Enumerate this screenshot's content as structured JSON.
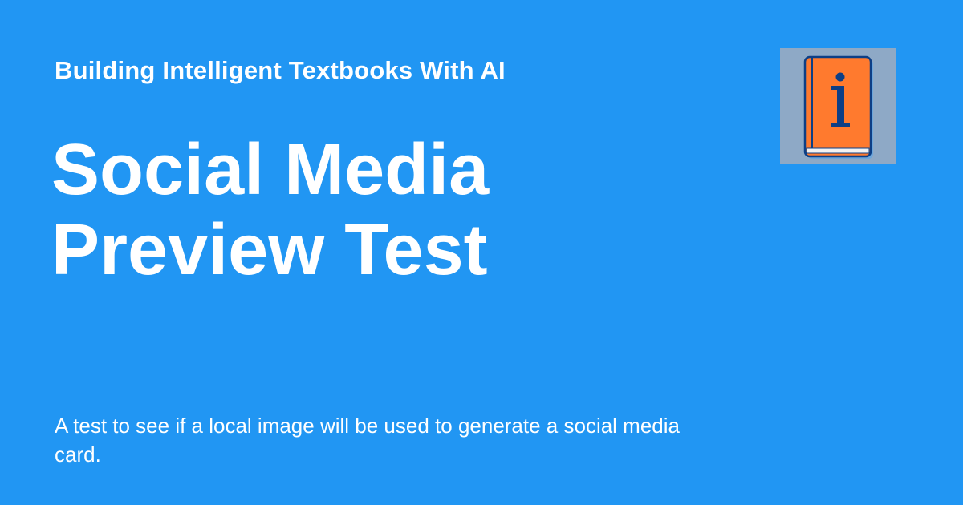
{
  "site_name": "Building Intelligent Textbooks With AI",
  "page_title": "Social Media Preview Test",
  "description": "A test to see if a local image will be used to generate a social media card.",
  "logo": {
    "icon": "orange-book-info-icon",
    "letter": "i"
  },
  "colors": {
    "background": "#2196f3",
    "text": "#ffffff",
    "book": "#ff7a2e",
    "book_outline": "#0d3f86",
    "logo_bg": "#8ea9c6"
  }
}
